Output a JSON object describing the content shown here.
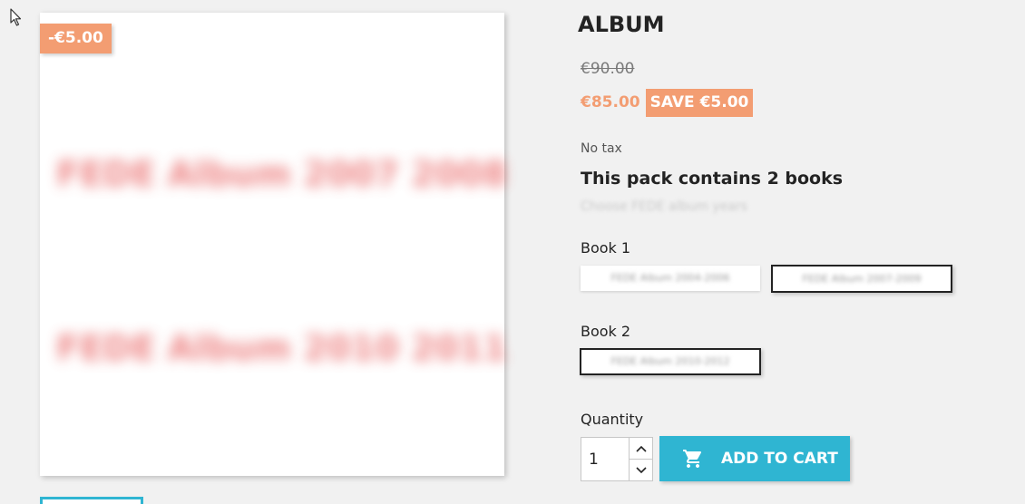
{
  "product": {
    "title": "ALBUM",
    "regular_price": "€90.00",
    "price": "€85.00",
    "save_badge": "SAVE €5.00",
    "discount_flag": "-€5.00",
    "tax_label": "No tax"
  },
  "image": {
    "line1": "FEDE Album 2007 2008",
    "line2": "FEDE Album 2010 2011"
  },
  "pack": {
    "heading": "This pack contains 2 books",
    "subheading": "Choose FEDE album years",
    "book1_label": "Book 1",
    "book1_options": [
      "FEDE Album 2004-2006",
      "FEDE Album 2007-2009"
    ],
    "book2_label": "Book 2",
    "book2_options": [
      "FEDE Album 2010-2012"
    ]
  },
  "quantity": {
    "label": "Quantity",
    "value": "1"
  },
  "cart": {
    "button_label": "ADD TO CART"
  },
  "colors": {
    "accent": "#2fb5d2",
    "discount": "#f39d72",
    "background": "#f1f1f1"
  }
}
